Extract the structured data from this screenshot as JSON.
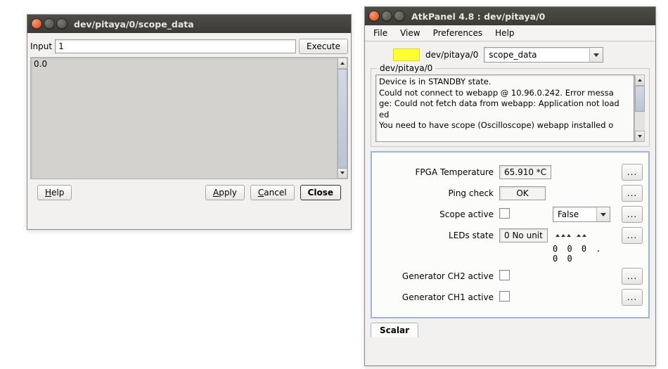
{
  "leftWindow": {
    "title": "dev/pitaya/0/scope_data",
    "inputLabel": "Input",
    "inputValue": "1",
    "executeLabel": "Execute",
    "outputValue": "0.0",
    "buttons": {
      "help": "Help",
      "apply": "Apply",
      "cancel": "Cancel",
      "close": "Close"
    }
  },
  "rightWindow": {
    "title": "AtkPanel  4.8  : dev/pitaya/0",
    "menu": {
      "file": "File",
      "view": "View",
      "preferences": "Preferences",
      "help": "Help"
    },
    "deviceLabel": "dev/pitaya/0",
    "commandSelected": "scope_data",
    "status_color": "#ffff33",
    "groupLabel": "dev/pitaya/0",
    "logLines": [
      "Device is in STANDBY state.",
      "Could not connect to webapp @ 10.96.0.242. Error messa",
      "ge: Could not fetch data from webapp: Application not load",
      "ed",
      "You need to have scope (Oscilloscope) webapp installed o"
    ],
    "attrs": {
      "fpgaTemp": {
        "label": "FPGA Temperature",
        "value": "65.910 *C"
      },
      "pingCheck": {
        "label": "Ping check",
        "value": "OK"
      },
      "scopeActive": {
        "label": "Scope active",
        "checked": false,
        "combo": "False"
      },
      "ledsState": {
        "label": "LEDs state",
        "value": "0 No unit",
        "spin": "0 0 0 . 0 0"
      },
      "genCh2": {
        "label": "Generator CH2 active",
        "checked": false
      },
      "genCh1": {
        "label": "Generator CH1 active",
        "checked": false
      }
    },
    "tabLabel": "Scalar",
    "ellipsis": "..."
  }
}
